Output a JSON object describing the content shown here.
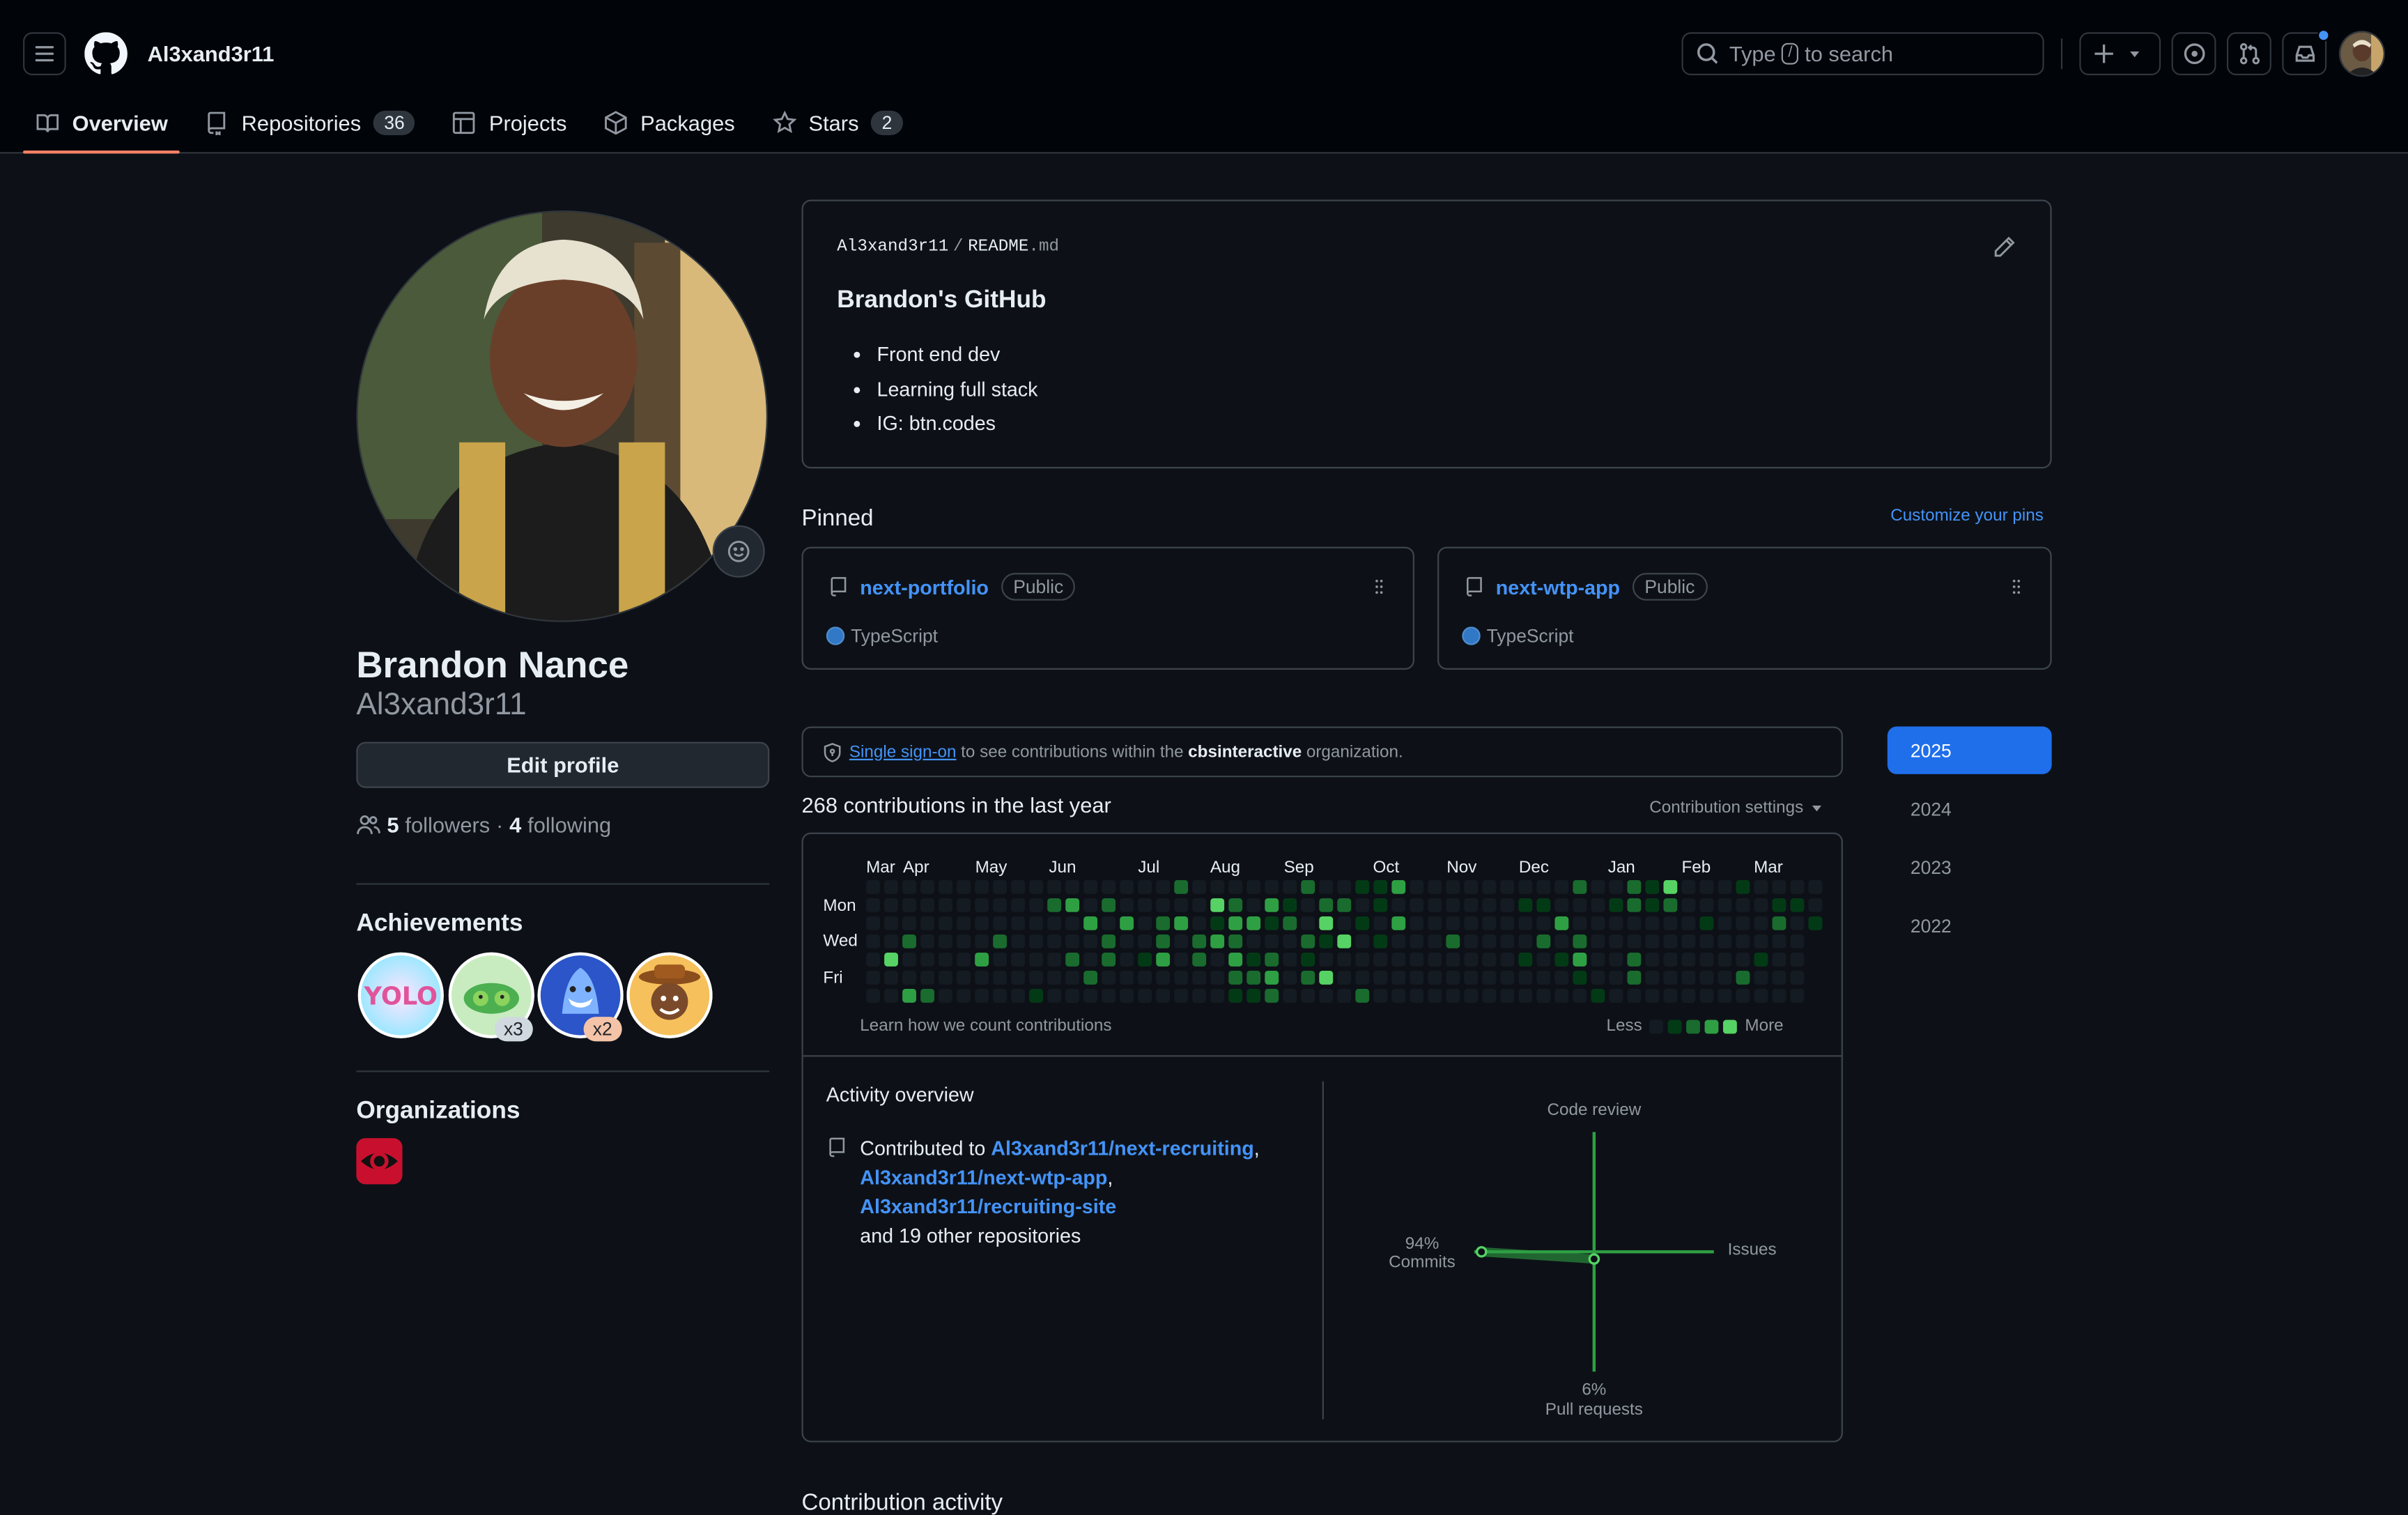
{
  "header": {
    "username": "Al3xand3r11",
    "search_prefix": "Type",
    "search_key": "/",
    "search_suffix": "to search",
    "tabs": [
      {
        "label": "Overview",
        "count": null
      },
      {
        "label": "Repositories",
        "count": "36"
      },
      {
        "label": "Projects",
        "count": null
      },
      {
        "label": "Packages",
        "count": null
      },
      {
        "label": "Stars",
        "count": "2"
      }
    ],
    "notification_dot_color": "#4493f8"
  },
  "profile": {
    "full_name": "Brandon Nance",
    "login": "Al3xand3r11",
    "edit_label": "Edit profile",
    "followers_count": "5",
    "followers_label": "followers",
    "separator": "·",
    "following_count": "4",
    "following_label": "following",
    "achievements_title": "Achievements",
    "achievements": [
      {
        "name": "yolo",
        "count": ""
      },
      {
        "name": "pair-extraordinaire",
        "count": "x3"
      },
      {
        "name": "pull-shark",
        "count": "x2"
      },
      {
        "name": "quickdraw",
        "count": ""
      }
    ],
    "organizations_title": "Organizations",
    "organization_icon": "cbs-eye-logo"
  },
  "readme": {
    "owner": "Al3xand3r11",
    "slash": "/",
    "file": "README",
    "ext": ".md",
    "heading": "Brandon's GitHub",
    "items": [
      "Front end dev",
      "Learning full stack",
      "IG: btn.codes"
    ]
  },
  "pinned": {
    "title": "Pinned",
    "customize_label": "Customize your pins",
    "repos": [
      {
        "name": "next-portfolio",
        "visibility": "Public",
        "language": "TypeScript"
      },
      {
        "name": "next-wtp-app",
        "visibility": "Public",
        "language": "TypeScript"
      }
    ]
  },
  "sso": {
    "link": "Single sign-on",
    "text1": "to see contributions within the",
    "org": "cbsinteractive",
    "text2": "organization."
  },
  "contributions": {
    "summary": "268 contributions in the last year",
    "settings_label": "Contribution settings",
    "months": [
      "Mar",
      "Apr",
      "May",
      "Jun",
      "Jul",
      "Aug",
      "Sep",
      "Oct",
      "Nov",
      "Dec",
      "Jan",
      "Feb",
      "Mar"
    ],
    "days": [
      "Mon",
      "Wed",
      "Fri"
    ],
    "learn_label": "Learn how we count contributions",
    "less_label": "Less",
    "more_label": "More",
    "level_colors": [
      "#151b23",
      "#033a16",
      "#196c2e",
      "#2ea043",
      "#56d364"
    ],
    "years": [
      "2025",
      "2024",
      "2023",
      "2022"
    ],
    "selected_year": "2025"
  },
  "activity": {
    "title": "Activity overview",
    "contributed_to": "Contributed to",
    "repos": [
      "Al3xand3r11/next-recruiting",
      "Al3xand3r11/next-wtp-app",
      "Al3xand3r11/recruiting-site"
    ],
    "comma": ",",
    "others": "and 19 other repositories",
    "axes": {
      "code_review": "Code review",
      "issues": "Issues",
      "commits_pct": "94%",
      "commits": "Commits",
      "pr_pct": "6%",
      "pull_requests": "Pull requests"
    },
    "chart_data": {
      "type": "other",
      "categories": [
        "Commits",
        "Code review",
        "Issues",
        "Pull requests"
      ],
      "values": [
        94,
        0,
        0,
        6
      ]
    }
  },
  "contribution_activity_title": "Contribution activity"
}
